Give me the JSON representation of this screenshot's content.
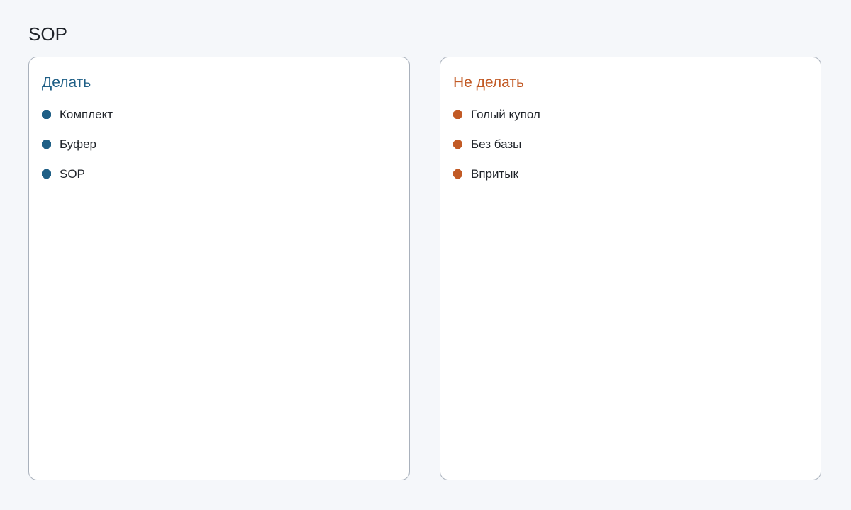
{
  "page": {
    "title": "SOP"
  },
  "panels": [
    {
      "heading": "Делать",
      "accent": "#1f5f86",
      "bullet_icon": "octagon-bullet-icon",
      "items": [
        "Комплект",
        "Буфер",
        "SOP"
      ]
    },
    {
      "heading": "Не делать",
      "accent": "#c25a25",
      "bullet_icon": "octagon-bullet-icon",
      "items": [
        "Голый купол",
        "Без базы",
        "Впритык"
      ]
    }
  ]
}
